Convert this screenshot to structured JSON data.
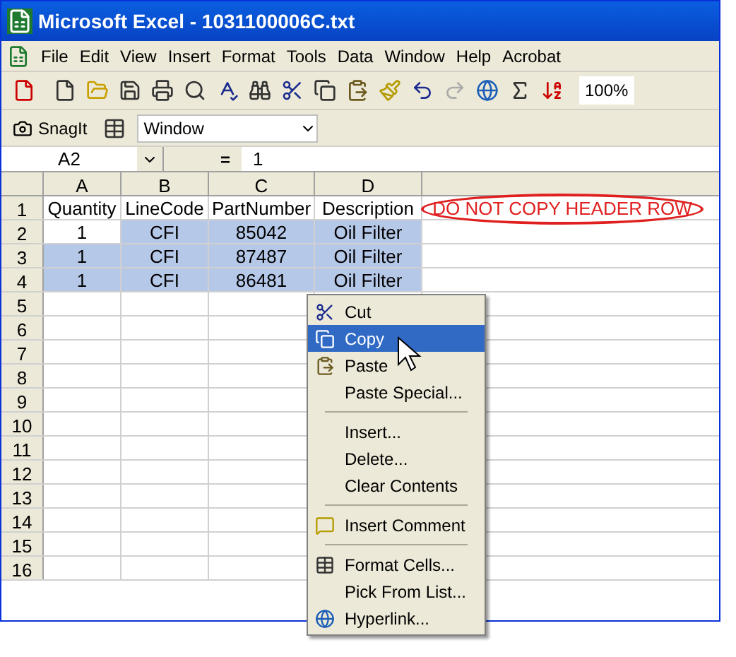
{
  "window": {
    "title": "Microsoft Excel - 1031100006C.txt"
  },
  "menu_bar": [
    "File",
    "Edit",
    "View",
    "Insert",
    "Format",
    "Tools",
    "Data",
    "Window",
    "Help",
    "Acrobat"
  ],
  "toolbar": {
    "zoom": "100%"
  },
  "snagit_toolbar": {
    "label": "SnagIt",
    "dropdown": "Window"
  },
  "formula_bar": {
    "name_box": "A2",
    "equals": "=",
    "value": "1"
  },
  "columns": [
    "A",
    "B",
    "C",
    "D"
  ],
  "rows": [
    {
      "number": "1",
      "cells": [
        "Quantity",
        "LineCode",
        "PartNumber",
        "Description"
      ],
      "selected": false
    },
    {
      "number": "2",
      "cells": [
        "1",
        "CFI",
        "85042",
        "Oil Filter"
      ],
      "selected": true
    },
    {
      "number": "3",
      "cells": [
        "1",
        "CFI",
        "87487",
        "Oil Filter"
      ],
      "selected": true
    },
    {
      "number": "4",
      "cells": [
        "1",
        "CFI",
        "86481",
        "Oil Filter"
      ],
      "selected": true
    },
    {
      "number": "5"
    },
    {
      "number": "6"
    },
    {
      "number": "7"
    },
    {
      "number": "8"
    },
    {
      "number": "9"
    },
    {
      "number": "10"
    },
    {
      "number": "11"
    },
    {
      "number": "12"
    },
    {
      "number": "13"
    },
    {
      "number": "14"
    },
    {
      "number": "15"
    },
    {
      "number": "16"
    }
  ],
  "annotation": "DO NOT COPY HEADER ROW",
  "context_menu": [
    {
      "kind": "item",
      "label": "Cut",
      "selected": false
    },
    {
      "kind": "item",
      "label": "Copy",
      "selected": true
    },
    {
      "kind": "item",
      "label": "Paste",
      "selected": false
    },
    {
      "kind": "item",
      "label": "Paste Special...",
      "selected": false
    },
    {
      "kind": "separator"
    },
    {
      "kind": "item",
      "label": "Insert...",
      "selected": false
    },
    {
      "kind": "item",
      "label": "Delete...",
      "selected": false
    },
    {
      "kind": "item",
      "label": "Clear Contents",
      "selected": false
    },
    {
      "kind": "separator"
    },
    {
      "kind": "item",
      "label": "Insert Comment",
      "selected": false
    },
    {
      "kind": "separator"
    },
    {
      "kind": "item",
      "label": "Format Cells...",
      "selected": false
    },
    {
      "kind": "item",
      "label": "Pick From List...",
      "selected": false
    },
    {
      "kind": "item",
      "label": "Hyperlink...",
      "selected": false
    }
  ]
}
